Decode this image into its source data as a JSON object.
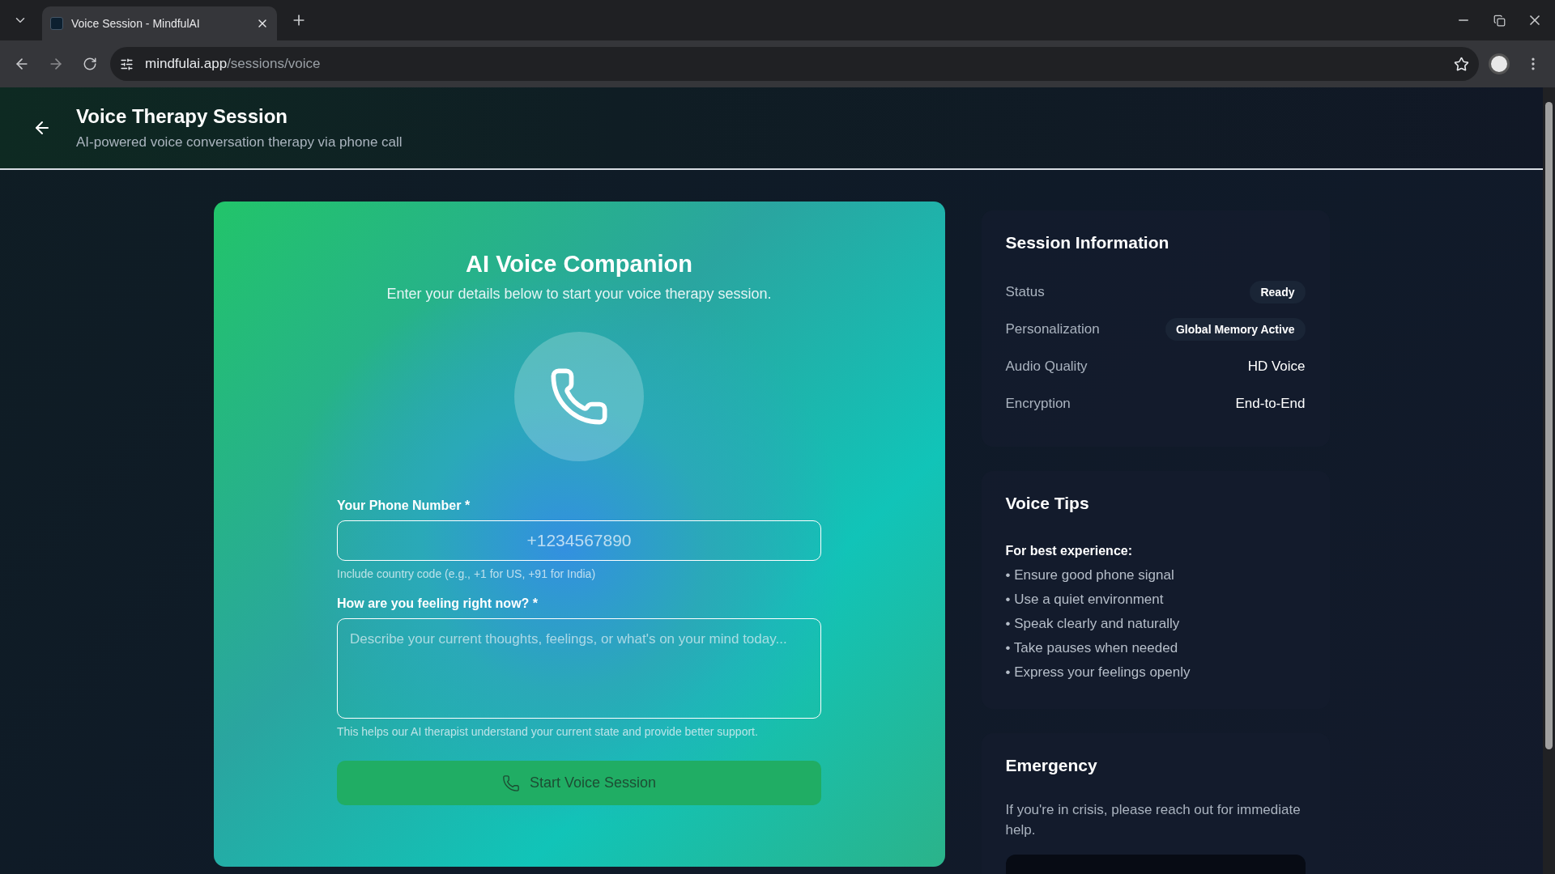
{
  "browser": {
    "tab_title": "Voice Session - MindfulAI",
    "url_host": "mindfulai.app",
    "url_path": "/sessions/voice"
  },
  "header": {
    "title": "Voice Therapy Session",
    "subtitle": "AI-powered voice conversation therapy via phone call"
  },
  "companion": {
    "title": "AI Voice Companion",
    "subtitle": "Enter your details below to start your voice therapy session.",
    "phone_label": "Your Phone Number *",
    "phone_placeholder": "+1234567890",
    "phone_hint": "Include country code (e.g., +1 for US, +91 for India)",
    "feeling_label": "How are you feeling right now? *",
    "feeling_placeholder": "Describe your current thoughts, feelings, or what's on your mind today...",
    "feeling_hint": "This helps our AI therapist understand your current state and provide better support.",
    "start_button": {
      "label": "Start Voice Session",
      "disabled": true
    }
  },
  "session_info": {
    "title": "Session Information",
    "rows": [
      {
        "label": "Status",
        "value": "Ready",
        "kind": "badge"
      },
      {
        "label": "Personalization",
        "value": "Global Memory Active",
        "kind": "badge"
      },
      {
        "label": "Audio Quality",
        "value": "HD Voice",
        "kind": "text"
      },
      {
        "label": "Encryption",
        "value": "End-to-End",
        "kind": "text"
      }
    ]
  },
  "voice_tips": {
    "title": "Voice Tips",
    "lead": "For best experience:",
    "tips": [
      "• Ensure good phone signal",
      "• Use a quiet environment",
      "• Speak clearly and naturally",
      "• Take pauses when needed",
      "• Express your feelings openly"
    ]
  },
  "emergency": {
    "title": "Emergency",
    "text": "If you're in crisis, please reach out for immediate help."
  }
}
